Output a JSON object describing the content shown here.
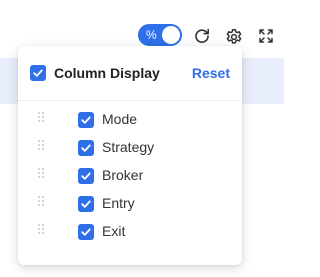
{
  "toolbar": {
    "percent_toggle": {
      "label": "%",
      "enabled": true
    },
    "icons": [
      "refresh-icon",
      "gear-icon",
      "fullscreen-icon"
    ]
  },
  "popover": {
    "title": "Column Display",
    "reset_label": "Reset",
    "select_all_checked": true,
    "columns": [
      {
        "label": "Mode",
        "checked": true
      },
      {
        "label": "Strategy",
        "checked": true
      },
      {
        "label": "Broker",
        "checked": true
      },
      {
        "label": "Entry",
        "checked": true
      },
      {
        "label": "Exit",
        "checked": true
      }
    ]
  },
  "colors": {
    "accent": "#2f6fe8",
    "header_band": "#e9eefc",
    "icon": "#333333",
    "handle": "#c8c8c8"
  }
}
